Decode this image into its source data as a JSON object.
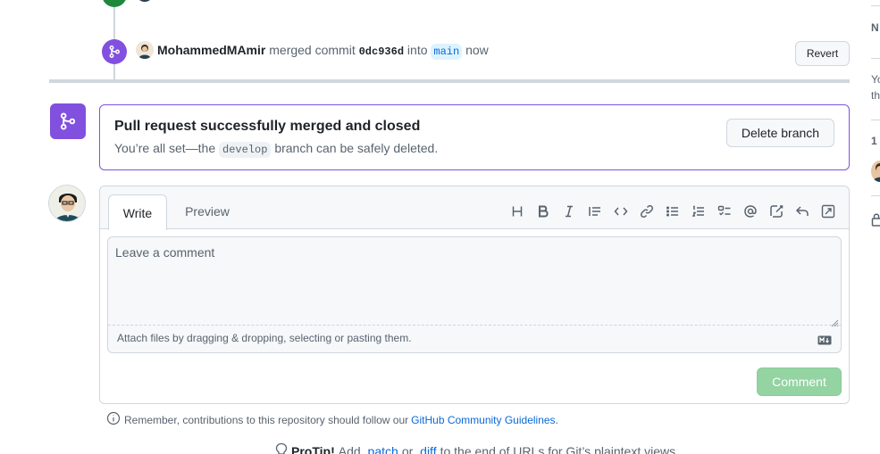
{
  "timeline_event": {
    "user": "MohammedMAmir",
    "action": "merged commit",
    "commit_sha": "0dc936d",
    "into": "into",
    "branch": "main",
    "time": "now",
    "revert_label": "Revert"
  },
  "merge_status": {
    "title": "Pull request successfully merged and closed",
    "sub_prefix": "You’re all set—the",
    "branch": "develop",
    "sub_suffix": "branch can be safely deleted.",
    "delete_label": "Delete branch"
  },
  "comment": {
    "tabs": [
      "Write",
      "Preview"
    ],
    "toolbar_icons": [
      "heading-icon",
      "bold-icon",
      "italic-icon",
      "quote-icon",
      "code-icon",
      "link-icon",
      "unordered-list-icon",
      "ordered-list-icon",
      "task-list-icon",
      "mention-icon",
      "cross-reference-icon",
      "reply-icon",
      "fullscreen-icon"
    ],
    "placeholder": "Leave a comment",
    "attach_text": "Attach files by dragging & dropping, selecting or pasting them.",
    "submit_label": "Comment"
  },
  "reminder": {
    "text": "Remember, contributions to this repository should follow our",
    "link": "GitHub Community Guidelines",
    "end": "."
  },
  "protip": {
    "bold": "ProTip!",
    "text1": "Add",
    "link1": ".patch",
    "or": "or",
    "link2": ".diff",
    "text2": "to the end of URLs for Git’s plaintext views."
  },
  "sidebar": {
    "frag_n": "N",
    "frag_yo": "Yo",
    "frag_th": "th",
    "frag_1": "1"
  },
  "colors": {
    "merged_purple": "#8250df",
    "open_green": "#1f883d",
    "link_blue": "#0969da",
    "comment_btn_disabled": "#94d3a2"
  }
}
